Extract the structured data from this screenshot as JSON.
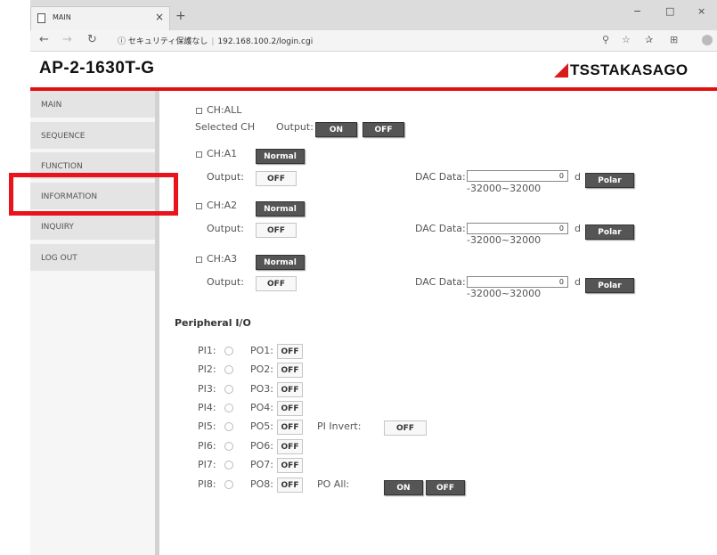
{
  "browser": {
    "tab_title": "MAIN",
    "tab_close": "×",
    "new_tab": "+",
    "security_text": "ⓘ セキュリティ保護なし",
    "url": "192.168.100.2/login.cgi",
    "window": {
      "minimize": "−",
      "maximize": "□",
      "close": "×"
    }
  },
  "header": {
    "model": "AP-2-1630T-G",
    "logo_text": "TSSTAKASAGO"
  },
  "sidebar": {
    "items": [
      {
        "label": "MAIN"
      },
      {
        "label": "SEQUENCE"
      },
      {
        "label": "FUNCTION"
      },
      {
        "label": "INFORMATION"
      },
      {
        "label": "INQUIRY"
      },
      {
        "label": "LOG OUT"
      }
    ]
  },
  "main": {
    "ch_all": "CH:ALL",
    "selected_ch": "Selected CH",
    "output_label": "Output:",
    "on": "ON",
    "off": "OFF",
    "normal": "Normal",
    "dac_label": "DAC Data:",
    "dac_unit": "d",
    "polar": "Polar",
    "dac_range": "-32000~32000",
    "channels": [
      {
        "name": "CH:A1",
        "dac_value": "0",
        "output": "OFF"
      },
      {
        "name": "CH:A2",
        "dac_value": "0",
        "output": "OFF"
      },
      {
        "name": "CH:A3",
        "dac_value": "0",
        "output": "OFF"
      }
    ]
  },
  "peripheral": {
    "title": "Peripheral I/O",
    "pi": [
      "PI1:",
      "PI2:",
      "PI3:",
      "PI4:",
      "PI5:",
      "PI6:",
      "PI7:",
      "PI8:"
    ],
    "po": [
      "PO1:",
      "PO2:",
      "PO3:",
      "PO4:",
      "PO5:",
      "PO6:",
      "PO7:",
      "PO8:"
    ],
    "po_state": "OFF",
    "pi_invert_label": "PI Invert:",
    "pi_invert_state": "OFF",
    "po_all_label": "PO All:",
    "po_all_on": "ON",
    "po_all_off": "OFF"
  }
}
